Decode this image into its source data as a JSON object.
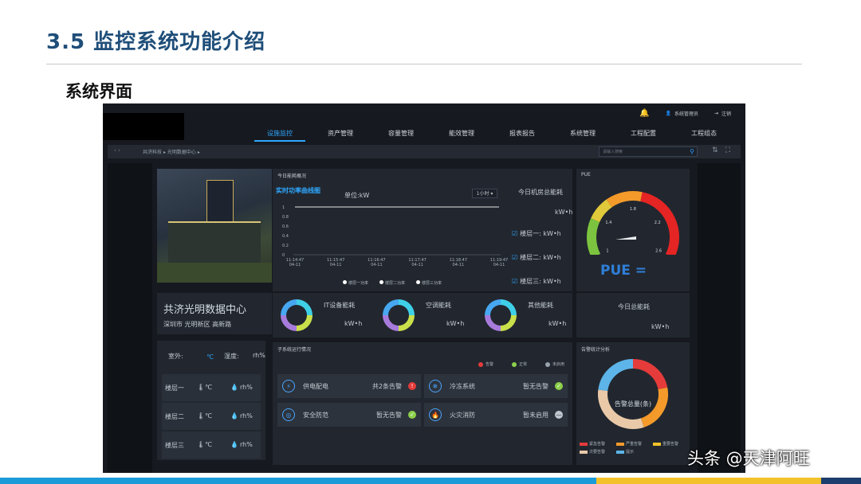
{
  "slide": {
    "title": "3.5 监控系统功能介绍",
    "subtitle": "系统界面",
    "watermark": "头条 @天津阿旺"
  },
  "topbar": {
    "user_label": "系统管理员",
    "logout_label": "注销"
  },
  "nav": {
    "items": [
      "设施监控",
      "资产管理",
      "容量管理",
      "能效管理",
      "报表报告",
      "系统管理",
      "工程配置",
      "工程组态"
    ],
    "active_index": 0
  },
  "breadcrumb": {
    "items": [
      "共济科技",
      "▸",
      "光明数据中心",
      "▸"
    ],
    "search_placeholder": "请输入搜索"
  },
  "site": {
    "name": "共济光明数据中心",
    "address": "深圳市 光明新区 高新路"
  },
  "environment": {
    "outdoor_label": "室外:",
    "outdoor_temp_unit": "℃",
    "humidity_label": "湿度:",
    "humidity_unit": "rh%",
    "floors": [
      {
        "name": "楼层一",
        "temp": "℃",
        "humidity": "rh%"
      },
      {
        "name": "楼层二",
        "temp": "℃",
        "humidity": "rh%"
      },
      {
        "name": "楼层三",
        "temp": "℃",
        "humidity": "rh%"
      }
    ]
  },
  "energy": {
    "panel_title": "今日能耗概况",
    "chart_title": "实时功率曲线图",
    "unit_label": "单位:kW",
    "dropdown_value": "1小时",
    "total_label": "今日机房总能耗",
    "total_unit": "kW•h",
    "floors": [
      {
        "label": "楼层一: kW•h"
      },
      {
        "label": "楼层二: kW•h"
      },
      {
        "label": "楼层三: kW•h"
      }
    ],
    "categories": [
      {
        "name": "IT设备能耗",
        "unit": "kW•h"
      },
      {
        "name": "空调能耗",
        "unit": "kW•h"
      },
      {
        "name": "其他能耗",
        "unit": "kW•h"
      }
    ]
  },
  "pue": {
    "panel_title": "PUE",
    "label": "PUE =",
    "gauge_ticks": [
      "1",
      "1.4",
      "1.8",
      "2.2",
      "2.6"
    ],
    "daily_label": "今日总能耗",
    "daily_unit": "kW•h"
  },
  "subsystems": {
    "panel_title": "子系统运行情况",
    "legend": [
      {
        "label": "告警",
        "color": "#e53b3b"
      },
      {
        "label": "正常",
        "color": "#8cd04a"
      },
      {
        "label": "未启用",
        "color": "#9aa3ad"
      }
    ],
    "items": [
      {
        "name": "供电配电",
        "status": "共2条告警",
        "state_color": "#e53b3b",
        "glyph": "!"
      },
      {
        "name": "冷冻系统",
        "status": "暂无告警",
        "state_color": "#8cd04a",
        "glyph": "✓"
      },
      {
        "name": "安全防范",
        "status": "暂无告警",
        "state_color": "#8cd04a",
        "glyph": "✓"
      },
      {
        "name": "火灾消防",
        "status": "暂未启用",
        "state_color": "#bfc6ce",
        "glyph": "—"
      }
    ]
  },
  "alarm_stats": {
    "panel_title": "告警统计分析",
    "center_label": "告警总量(条)",
    "legend": [
      {
        "label": "紧急告警",
        "color": "#e53b3b"
      },
      {
        "label": "严重告警",
        "color": "#f39a2a"
      },
      {
        "label": "重要告警",
        "color": "#f3c22a"
      },
      {
        "label": "次要告警",
        "color": "#e9c9a8"
      },
      {
        "label": "提示",
        "color": "#5db4e8"
      }
    ]
  },
  "chart_data": {
    "type": "line",
    "title": "实时功率曲线图",
    "ylabel": "单位:kW",
    "x": [
      "11:14:47 04-11",
      "11:15:47 04-11",
      "11:16:47 04-11",
      "11:17:47 04-11",
      "11:18:47 04-11",
      "11:19:47 04-11"
    ],
    "y_ticks": [
      "0",
      "0.2",
      "0.4",
      "0.6",
      "0.8",
      "1"
    ],
    "ylim": [
      0,
      1
    ],
    "series": [
      {
        "name": "楼层一功率",
        "values": [
          1,
          1,
          1,
          1,
          1,
          1
        ]
      },
      {
        "name": "楼层二功率",
        "values": [
          1,
          1,
          1,
          1,
          1,
          1
        ]
      },
      {
        "name": "楼层三功率",
        "values": [
          1,
          1,
          1,
          1,
          1,
          1
        ]
      }
    ],
    "legend": "bottom"
  }
}
